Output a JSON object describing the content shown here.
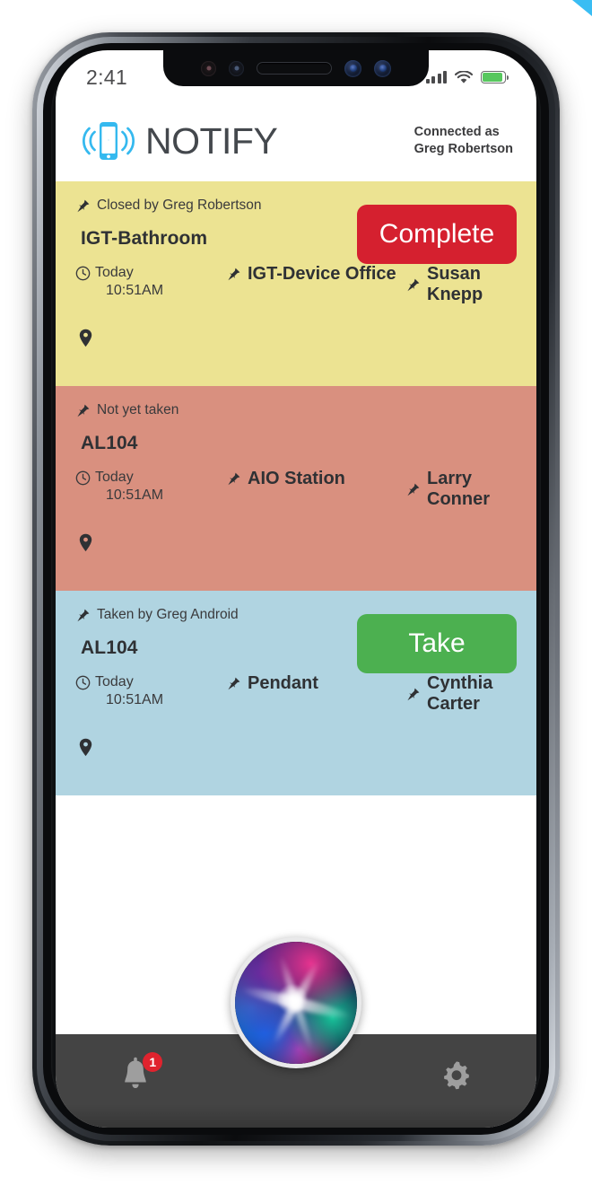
{
  "status_bar": {
    "time": "2:41",
    "signal_icon": "cellular-signal-icon",
    "wifi_icon": "wifi-icon",
    "battery_icon": "battery-icon"
  },
  "header": {
    "brand_name": "NOTIFY",
    "brand_icon": "notify-phone-logo-icon",
    "connected_label": "Connected as",
    "connected_user": "Greg Robertson"
  },
  "colors": {
    "card_closed": "#ece392",
    "card_not_taken": "#d9907f",
    "card_taken": "#b0d4e1",
    "button_complete": "#d5202f",
    "button_take": "#4cb050",
    "brand_accent": "#35b9ef",
    "nav_background": "#444444",
    "badge": "#e0232e"
  },
  "cards": [
    {
      "status": "Closed by Greg Robertson",
      "title": "IGT-Bathroom",
      "time_day": "Today",
      "time_clock": "10:51AM",
      "location": "IGT-Device Office",
      "person": "Susan Knepp",
      "action_label": "Complete",
      "action_type": "complete",
      "background": "#ece392",
      "pin_icon": "pushpin-icon",
      "clock_icon": "clock-icon",
      "map_icon": "map-marker-icon"
    },
    {
      "status": "Not yet taken",
      "title": "AL104",
      "time_day": "Today",
      "time_clock": "10:51AM",
      "location": "AIO Station",
      "person": "Larry Conner",
      "action_label": "",
      "action_type": "none",
      "background": "#d9907f",
      "pin_icon": "pushpin-icon",
      "clock_icon": "clock-icon",
      "map_icon": "map-marker-icon"
    },
    {
      "status": "Taken by Greg Android",
      "title": "AL104",
      "time_day": "Today",
      "time_clock": "10:51AM",
      "location": "Pendant",
      "person": "Cynthia Carter",
      "action_label": "Take",
      "action_type": "take",
      "background": "#b0d4e1",
      "pin_icon": "pushpin-icon",
      "clock_icon": "clock-icon",
      "map_icon": "map-marker-icon"
    }
  ],
  "bottom_nav": {
    "notifications_icon": "bell-icon",
    "notifications_badge": "1",
    "assistant_icon": "siri-orb-icon",
    "settings_icon": "gear-icon"
  }
}
